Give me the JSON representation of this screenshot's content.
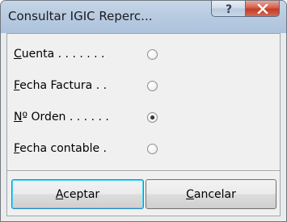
{
  "window": {
    "title": "Consultar  IGIC Reperc...",
    "help_glyph": "?",
    "close_glyph": "x"
  },
  "options": [
    {
      "label_first": "C",
      "label_rest": "uenta . . . . . . .",
      "selected": false
    },
    {
      "label_first": "F",
      "label_rest": "echa Factura . .",
      "selected": false
    },
    {
      "label_first": "N",
      "label_rest": "º Orden . . . . . .",
      "selected": true
    },
    {
      "label_first": "F",
      "label_rest": "echa contable .",
      "selected": false
    }
  ],
  "buttons": {
    "ok_first": "A",
    "ok_rest": "ceptar",
    "cancel_first": "C",
    "cancel_rest": "ancelar"
  }
}
